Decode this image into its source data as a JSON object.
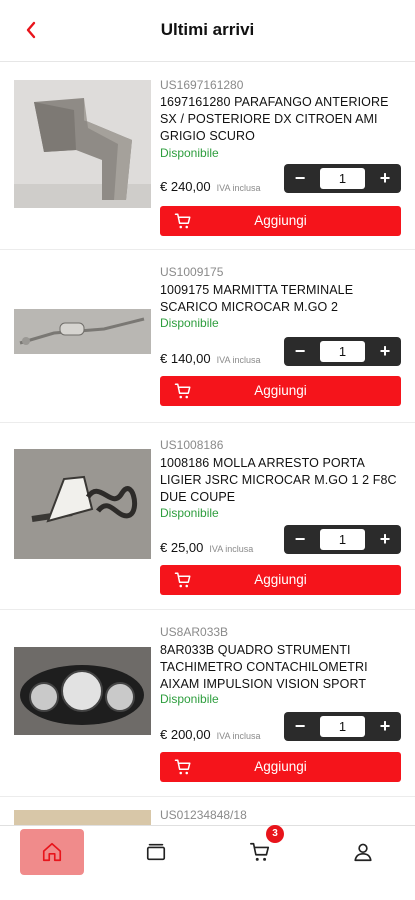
{
  "header": {
    "title": "Ultimi arrivi",
    "back_icon": "chevron-left-icon"
  },
  "products": [
    {
      "sku": "US1697161280",
      "name": "1697161280 PARAFANGO ANTERIORE SX / POSTERIORE DX CITROEN AMI GRIGIO SCURO",
      "availability": "Disponibile",
      "price": "€ 240,00",
      "vat": "IVA inclusa",
      "quantity": "1",
      "add_label": "Aggiungi"
    },
    {
      "sku": "US1009175",
      "name": "1009175 MARMITTA TERMINALE SCARICO MICROCAR M.GO 2",
      "availability": "Disponibile",
      "price": "€ 140,00",
      "vat": "IVA inclusa",
      "quantity": "1",
      "add_label": "Aggiungi"
    },
    {
      "sku": "US1008186",
      "name": "1008186 MOLLA ARRESTO PORTA LIGIER JSRC MICROCAR M.GO 1 2 F8C DUE COUPE",
      "availability": "Disponibile",
      "price": "€ 25,00",
      "vat": "IVA inclusa",
      "quantity": "1",
      "add_label": "Aggiungi"
    },
    {
      "sku": "US8AR033B",
      "name": "8AR033B QUADRO STRUMENTI TACHIMETRO CONTACHILOMETRI AIXAM IMPULSION VISION SPORT",
      "availability": "Disponibile",
      "price": "€ 200,00",
      "vat": "IVA inclusa",
      "quantity": "1",
      "add_label": "Aggiungi"
    }
  ],
  "partial_sku": "US01234848/18",
  "tabbar": {
    "tabs": [
      {
        "icon": "home-icon",
        "active": true
      },
      {
        "icon": "catalog-icon",
        "active": false
      },
      {
        "icon": "cart-icon",
        "active": false,
        "badge": "3"
      },
      {
        "icon": "user-icon",
        "active": false
      }
    ]
  },
  "colors": {
    "accent": "#f5141b",
    "available": "#2e9e3e",
    "active_tab": "#f08b8b",
    "stepper": "#2b2b2b"
  }
}
